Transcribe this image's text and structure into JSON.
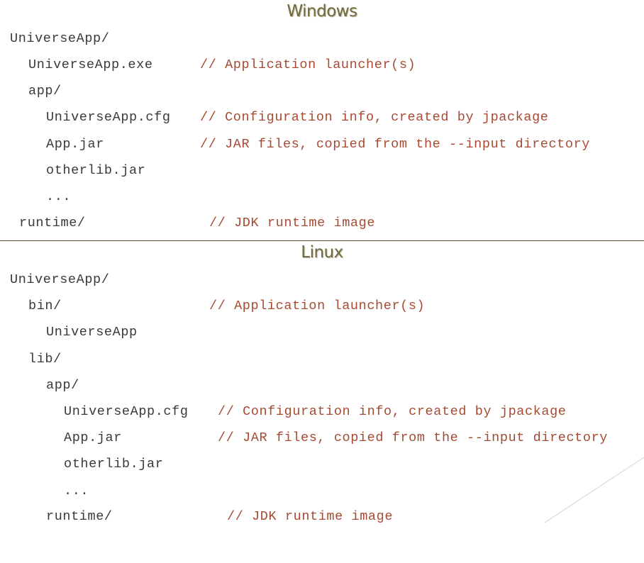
{
  "windows": {
    "heading": "Windows",
    "rows": [
      {
        "path": "UniverseApp/",
        "comment": ""
      },
      {
        "path": "UniverseApp.exe",
        "comment": "// Application launcher(s)"
      },
      {
        "path": "app/",
        "comment": ""
      },
      {
        "path": "UniverseApp.cfg",
        "comment": "// Configuration info, created by jpackage"
      },
      {
        "path": "App.jar",
        "comment": "// JAR files, copied from the --input directory"
      },
      {
        "path": "otherlib.jar",
        "comment": ""
      },
      {
        "path": "...",
        "comment": ""
      },
      {
        "path": "runtime/",
        "comment": "// JDK runtime image"
      }
    ]
  },
  "linux": {
    "heading": "Linux",
    "rows": [
      {
        "path": "UniverseApp/",
        "comment": ""
      },
      {
        "path": "bin/",
        "comment": "// Application launcher(s)"
      },
      {
        "path": "UniverseApp",
        "comment": ""
      },
      {
        "path": "lib/",
        "comment": ""
      },
      {
        "path": "app/",
        "comment": ""
      },
      {
        "path": "UniverseApp.cfg",
        "comment": "// Configuration info, created by jpackage"
      },
      {
        "path": "App.jar",
        "comment": "// JAR files, copied from the --input directory"
      },
      {
        "path": "otherlib.jar",
        "comment": ""
      },
      {
        "path": "...",
        "comment": ""
      },
      {
        "path": "runtime/",
        "comment": "// JDK runtime image"
      }
    ]
  },
  "colors": {
    "heading": "#6f6b3e",
    "path_text": "#3a3a3a",
    "comment_text": "#a64b33",
    "divider": "#5b4a3a"
  }
}
